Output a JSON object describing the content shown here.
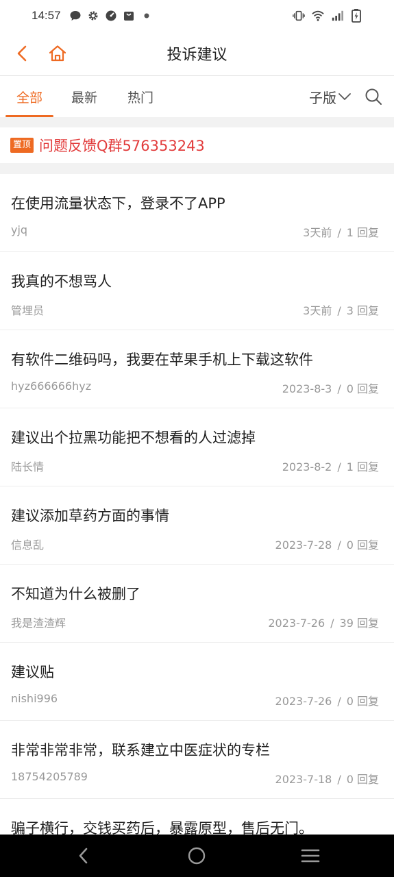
{
  "status_bar": {
    "time": "14:57",
    "left_icons": [
      "chat-bubble-icon",
      "gear-icon",
      "speedometer-icon",
      "bag-icon",
      "dot-icon"
    ],
    "right_icons": [
      "vibrate-icon",
      "wifi-icon",
      "signal-icon",
      "battery-charging-icon"
    ]
  },
  "nav": {
    "title": "投诉建议",
    "accent": "#ee6a22"
  },
  "tabs": {
    "items": [
      {
        "label": "全部",
        "active": true
      },
      {
        "label": "最新",
        "active": false
      },
      {
        "label": "热门",
        "active": false
      }
    ],
    "sub_label": "子版"
  },
  "pinned": {
    "badge": "置顶",
    "text": "问题反馈Q群576353243",
    "color": "#e23c3c"
  },
  "posts": [
    {
      "title": "在使用流量状态下，登录不了APP",
      "author": "yjq",
      "time": "3天前",
      "replies": "1 回复"
    },
    {
      "title": "我真的不想骂人",
      "author": "管埋员",
      "time": "3天前",
      "replies": "3 回复"
    },
    {
      "title": "有软件二维码吗，我要在苹果手机上下载这软件",
      "author": "hyz666666hyz",
      "time": "2023-8-3",
      "replies": "0 回复"
    },
    {
      "title": "建议出个拉黑功能把不想看的人过滤掉",
      "author": "陆长情",
      "time": "2023-8-2",
      "replies": "1 回复"
    },
    {
      "title": "建议添加草药方面的事情",
      "author": "信息乱",
      "time": "2023-7-28",
      "replies": "0 回复"
    },
    {
      "title": "不知道为什么被删了",
      "author": "我是渣渣辉",
      "time": "2023-7-26",
      "replies": "39 回复"
    },
    {
      "title": "建议贴",
      "author": "nishi996",
      "time": "2023-7-26",
      "replies": "0 回复"
    },
    {
      "title": "非常非常非常，联系建立中医症状的专栏",
      "author": "18754205789",
      "time": "2023-7-18",
      "replies": "0 回复"
    },
    {
      "title": "骗子横行，交钱买药后，暴露原型，售后无门。",
      "author": "",
      "time": "",
      "replies": ""
    }
  ],
  "meta_separator": "/",
  "system_nav": [
    "back-triangle-icon",
    "home-circle-icon",
    "recents-menu-icon"
  ]
}
